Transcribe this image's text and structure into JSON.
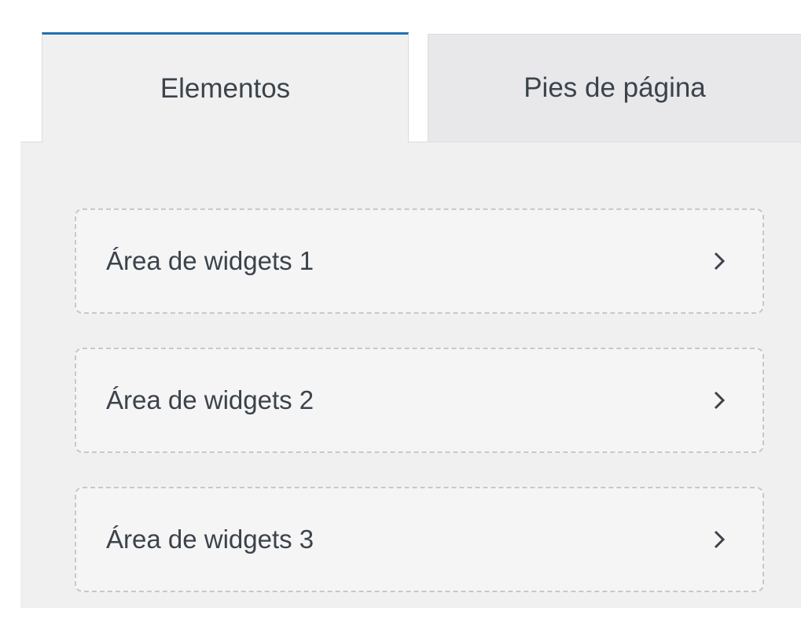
{
  "tabs": [
    {
      "label": "Elementos",
      "active": true
    },
    {
      "label": "Pies de página",
      "active": false
    }
  ],
  "widget_areas": [
    {
      "label": "Área de widgets 1"
    },
    {
      "label": "Área de widgets 2"
    },
    {
      "label": "Área de widgets 3"
    }
  ],
  "colors": {
    "accent": "#2271b1",
    "panel_bg": "#f0f0f1",
    "text": "#3c434a",
    "border": "#dcdcde"
  },
  "icons": {
    "row_arrow": "chevron-right-icon"
  }
}
